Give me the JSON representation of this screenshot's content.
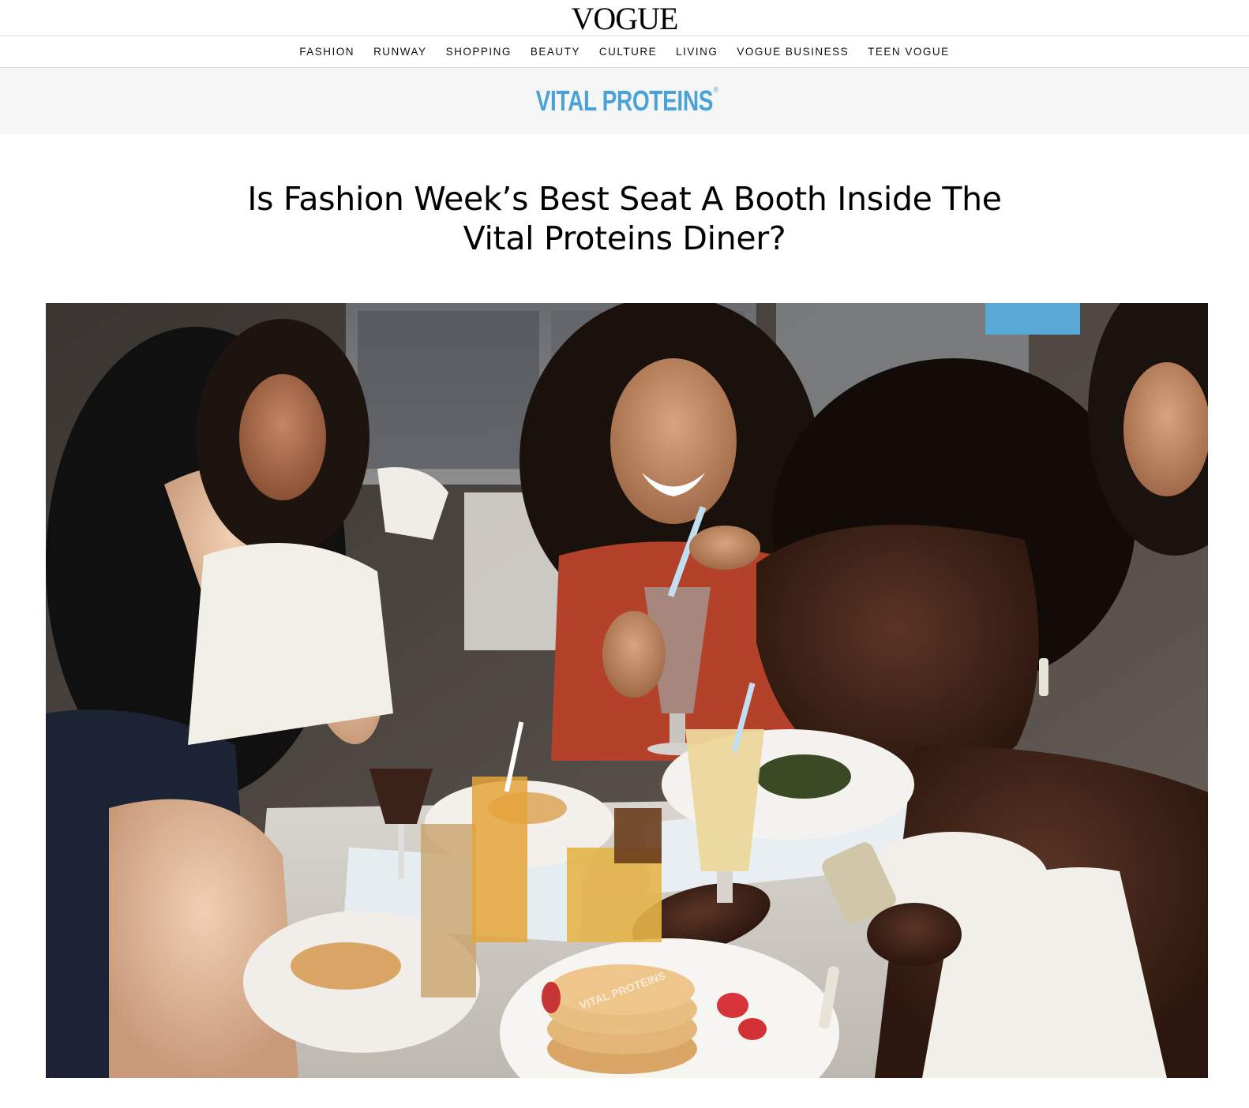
{
  "header": {
    "logo_text": "VOGUE"
  },
  "nav": {
    "items": [
      {
        "label": "FASHION"
      },
      {
        "label": "RUNWAY"
      },
      {
        "label": "SHOPPING"
      },
      {
        "label": "BEAUTY"
      },
      {
        "label": "CULTURE"
      },
      {
        "label": "LIVING"
      },
      {
        "label": "VOGUE BUSINESS"
      },
      {
        "label": "TEEN VOGUE"
      }
    ]
  },
  "sponsor": {
    "logo_text": "VITAL PROTEINS",
    "registered_mark": "®",
    "brand_color": "#4aa3d8"
  },
  "article": {
    "title": "Is Fashion Week’s Best Seat A Booth Inside The Vital Proteins Diner?"
  },
  "hero_image": {
    "pancake_stamp_text": "VITAL PROTEINS"
  }
}
